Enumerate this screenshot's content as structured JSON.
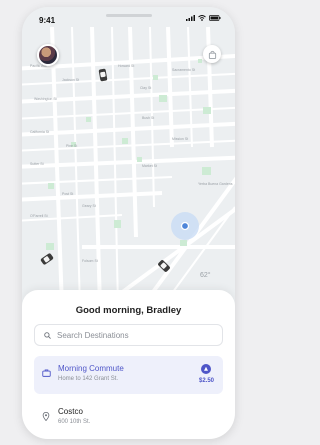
{
  "status_bar": {
    "time": "9:41"
  },
  "header": {
    "avatar_icon": "user-avatar",
    "bag_icon": "shopping-bag-icon"
  },
  "map": {
    "weather": "62°",
    "street_labels": [
      "Pacific Ave",
      "Jackson St",
      "Washington St",
      "Clay St",
      "Sacramento St",
      "California St",
      "Pine St",
      "Bush St",
      "Sutter St",
      "Post St",
      "Geary St",
      "O'Farrell St",
      "Market St",
      "Mission St",
      "Howard St",
      "Folsom St",
      "Yerba Buena Gardens"
    ],
    "colors": {
      "park": "#cdebd4",
      "road": "#ffffff",
      "block": "#eef0f2",
      "location_halo": "#c9dcf5",
      "location_dot": "#4f86d9"
    }
  },
  "sheet": {
    "greeting": "Good morning, Bradley",
    "search": {
      "placeholder": "Search Destinations",
      "icon": "search-icon"
    },
    "destinations": [
      {
        "title": "Morning Commute",
        "subtitle": "Home to 142 Grant St.",
        "price": "$2.50",
        "icon": "briefcase-icon",
        "badge_icon": "discount-icon",
        "selected": true
      },
      {
        "title": "Costco",
        "subtitle": "600 10th St.",
        "icon": "location-pin-icon",
        "selected": false
      }
    ]
  },
  "accent_color": "#4f56c8"
}
